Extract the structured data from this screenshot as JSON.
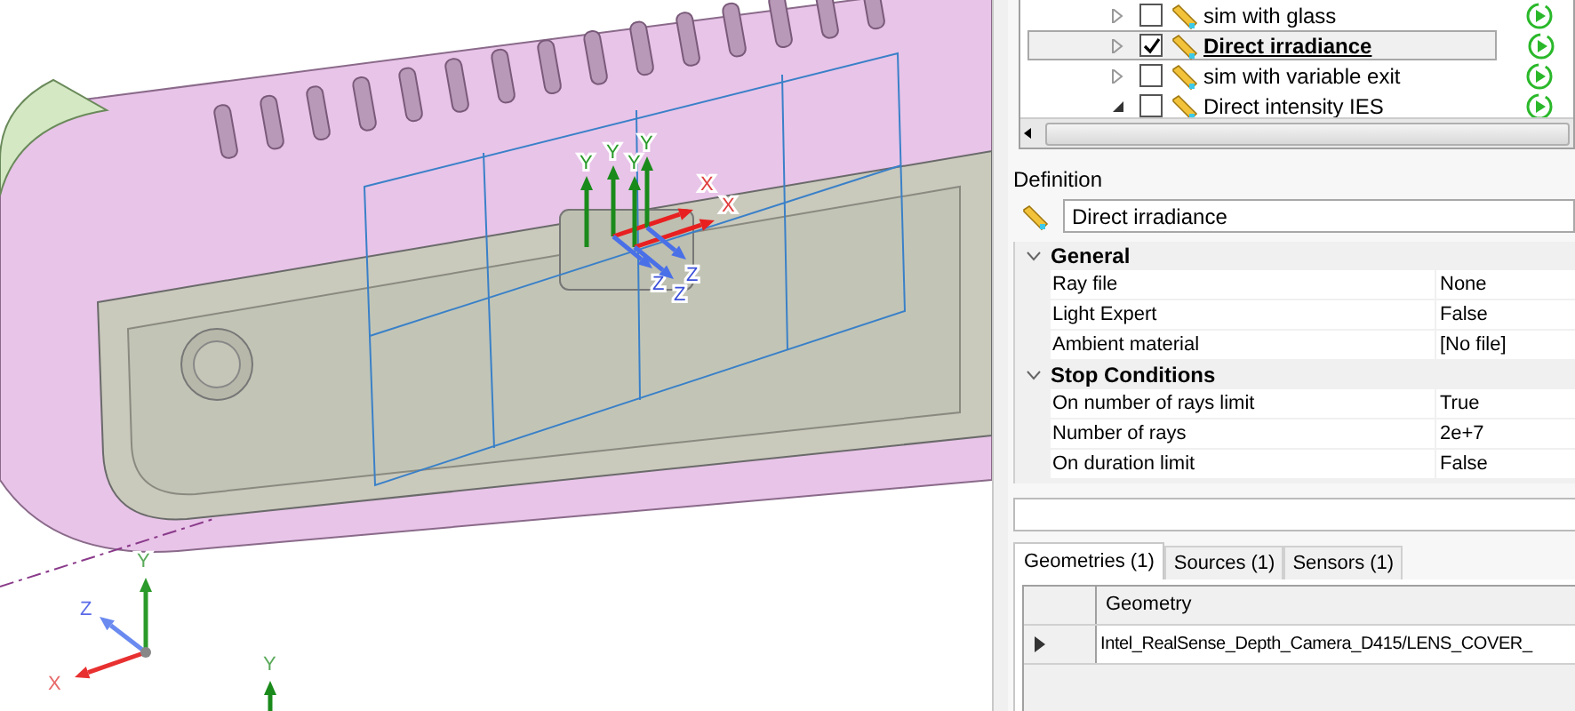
{
  "viewport": {
    "gizmo_frames": [
      {
        "y": "Y"
      },
      {
        "y": "Y",
        "x": "X",
        "z": "Z"
      },
      {
        "y": "Y",
        "x": "X",
        "z": "Z"
      },
      {
        "y": "Y",
        "z": "Z"
      }
    ],
    "triad": {
      "x": "X",
      "y": "Y",
      "z": "Z"
    },
    "second_triad": {
      "y": "Y"
    }
  },
  "simulation_tree": {
    "items": [
      {
        "label": "sim with glass",
        "checked": false,
        "selected": false,
        "expanded": false
      },
      {
        "label": "Direct irradiance",
        "checked": true,
        "selected": true,
        "expanded": false
      },
      {
        "label": "sim with variable exit",
        "checked": false,
        "selected": false,
        "expanded": false
      },
      {
        "label": "Direct intensity IES",
        "checked": false,
        "selected": false,
        "expanded": true
      }
    ]
  },
  "definition": {
    "title": "Definition",
    "name": "Direct irradiance",
    "categories": [
      {
        "name": "General",
        "expanded": true,
        "properties": [
          {
            "name": "Ray file",
            "value": "None"
          },
          {
            "name": "Light Expert",
            "value": "False"
          },
          {
            "name": "Ambient material",
            "value": "[No file]"
          }
        ]
      },
      {
        "name": "Stop Conditions",
        "expanded": true,
        "properties": [
          {
            "name": "On number of rays limit",
            "value": "True"
          },
          {
            "name": "Number of rays",
            "value": "2e+7"
          },
          {
            "name": "On duration limit",
            "value": "False"
          }
        ]
      }
    ]
  },
  "bottom_tabs": [
    {
      "label": "Geometries (1)",
      "selected": true
    },
    {
      "label": "Sources (1)",
      "selected": false
    },
    {
      "label": "Sensors (1)",
      "selected": false
    }
  ],
  "geometry_table": {
    "columns": [
      "Geometry"
    ],
    "rows": [
      {
        "current": true,
        "cells": [
          "Intel_RealSense_Depth_Camera_D415/LENS_COVER_"
        ]
      }
    ]
  }
}
